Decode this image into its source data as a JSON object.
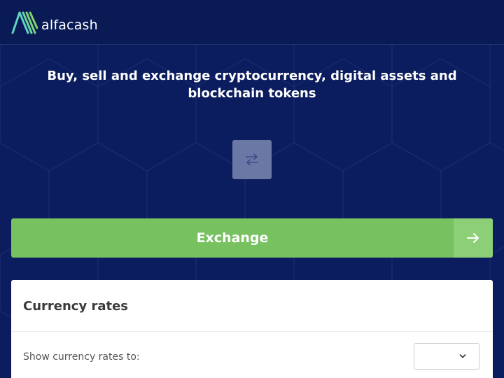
{
  "header": {
    "brand": "alfacash",
    "logo_icon": "alfacash-logo-icon"
  },
  "hero": {
    "title": "Buy, sell and exchange cryptocurrency, digital assets and blockchain tokens",
    "swap_icon": "swap-arrows-icon"
  },
  "exchange": {
    "label": "Exchange",
    "arrow_icon": "arrow-right-icon"
  },
  "rates": {
    "title": "Currency rates",
    "show_label": "Show currency rates to:",
    "selected": "",
    "select_icon": "chevron-down-icon"
  },
  "colors": {
    "background": "#0b1d5e",
    "accent_green": "#77c160",
    "card": "#ffffff"
  }
}
